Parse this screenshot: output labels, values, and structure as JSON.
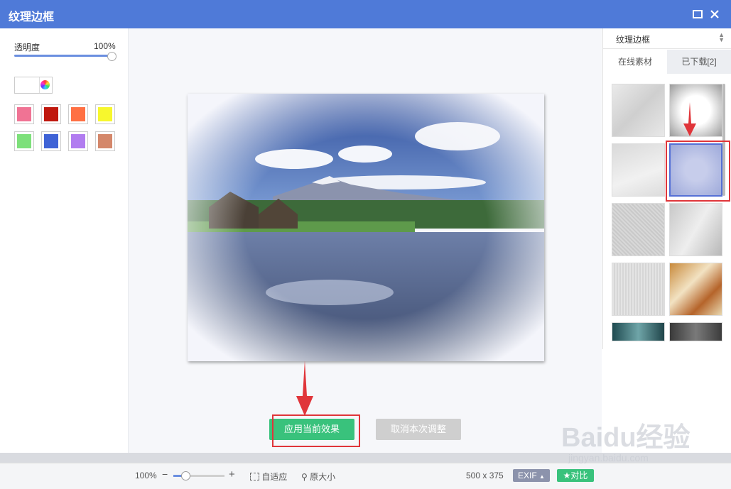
{
  "window": {
    "title": "纹理边框"
  },
  "left": {
    "opacity_label": "透明度",
    "opacity_value": "100%",
    "opacity_level": 1.0,
    "current_color": "#ffffff",
    "swatches": [
      "#f07394",
      "#c0180e",
      "#ff7043",
      "#f7f72d",
      "#7de07a",
      "#3f63d6",
      "#b17cf0",
      "#d4876a"
    ]
  },
  "center": {
    "apply_label": "应用当前效果",
    "cancel_label": "取消本次调整"
  },
  "right": {
    "dropdown_label": "纹理边框",
    "tab_online": "在线素材",
    "tab_downloaded": "已下载[2]"
  },
  "bottom": {
    "zoom_level": "100%",
    "zoom_minus": "−",
    "zoom_plus": "+",
    "fit_label": "自适应",
    "actual_size_label": "原大小",
    "image_size": "500 x 375",
    "exif_label": "EXIF",
    "compare_label": "对比"
  },
  "watermark": {
    "text": "Baidu经验",
    "url": "jingyan.baidu.com"
  },
  "colors": {
    "title_bar": "#4f7ad8",
    "accent_green": "#39c27c",
    "annotation_red": "#e0353a"
  }
}
